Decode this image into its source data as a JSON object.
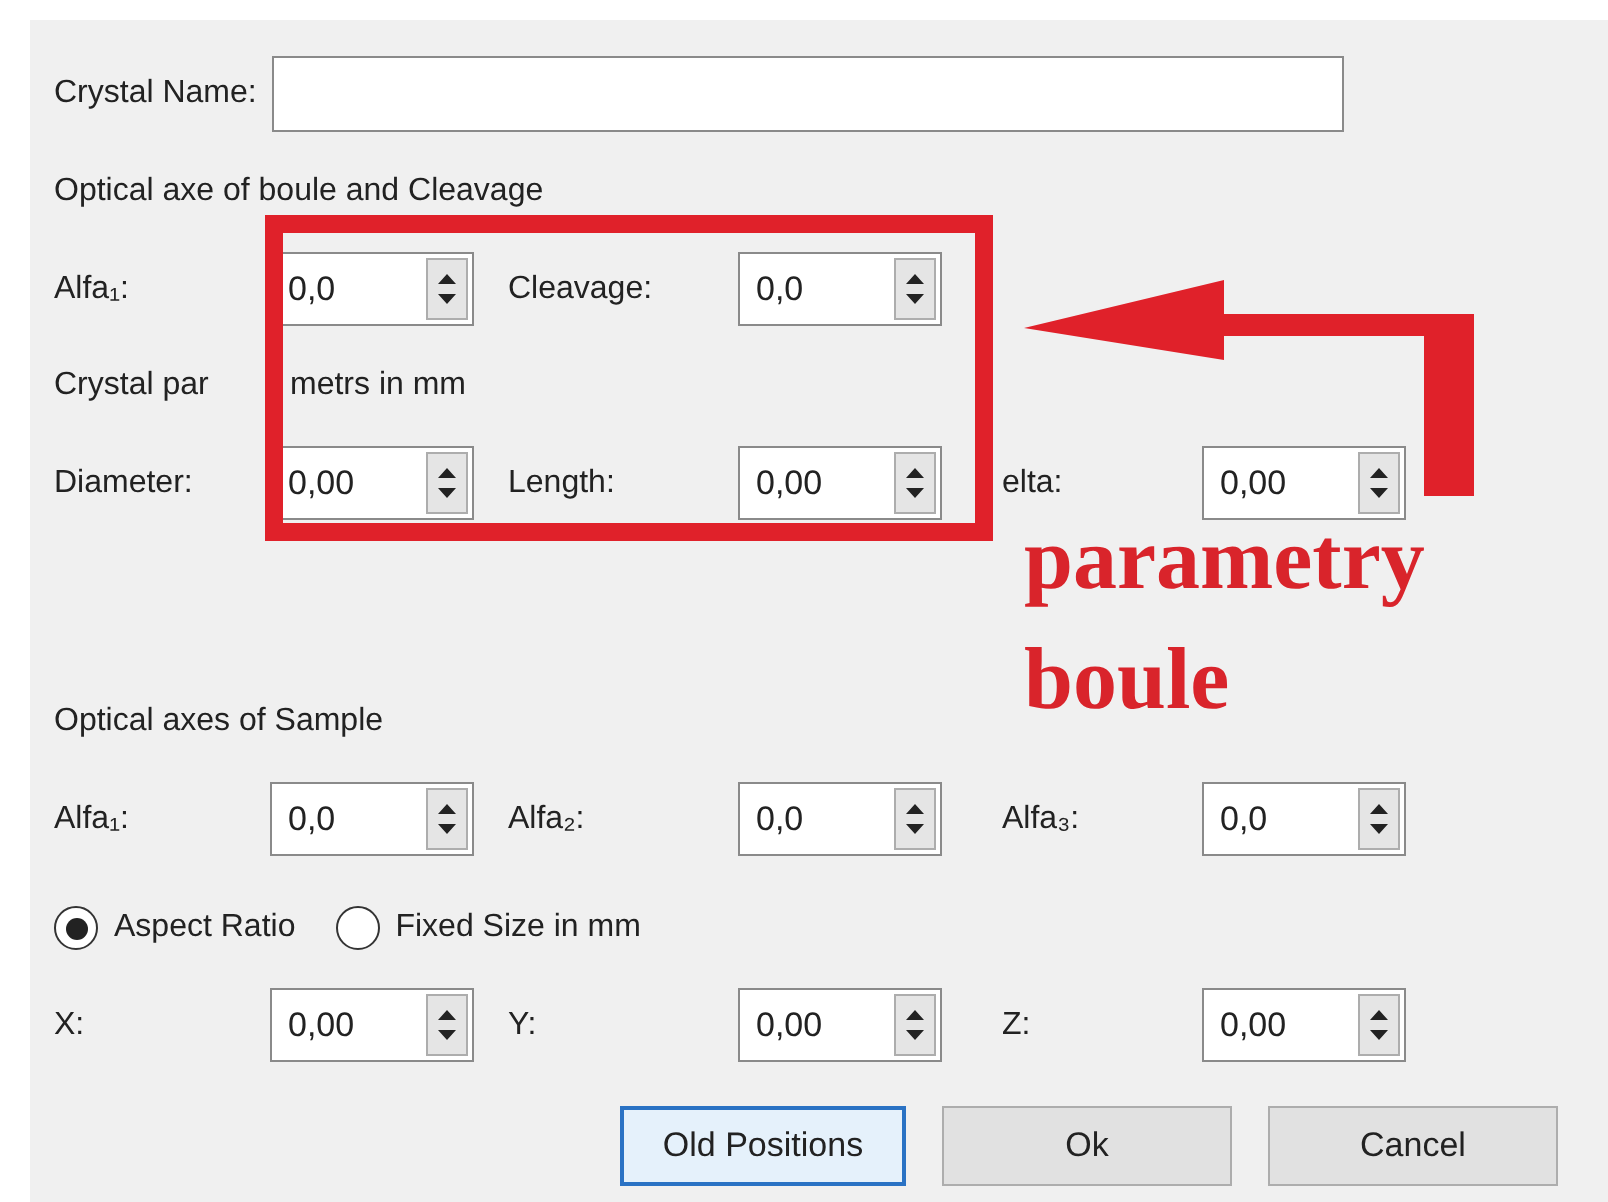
{
  "rows": [
    {
      "kind": "field",
      "label": "Crystal Name:"
    },
    {
      "kind": "heading",
      "text": "Optical axe of boule and Cleavage"
    },
    {
      "kind": "spins",
      "items": [
        {
          "label": "Alfa₁:",
          "value": "0,0"
        },
        {
          "label": "Cleavage:",
          "value": "0,0"
        }
      ]
    },
    {
      "kind": "heading",
      "parts": [
        "Crystal par",
        "metrs in mm"
      ]
    },
    {
      "kind": "spins",
      "items": [
        {
          "label": "Diameter:",
          "value": "0,00"
        },
        {
          "label": "Length:",
          "value": "0,00"
        },
        {
          "label": "elta:",
          "value": "0,00"
        }
      ]
    },
    {
      "kind": "heading",
      "text": "Optical axes of Sample"
    },
    {
      "kind": "spins",
      "items": [
        {
          "label": "Alfa₁:",
          "value": "0,0"
        },
        {
          "label": "Alfa₂:",
          "value": "0,0"
        },
        {
          "label": "Alfa₃:",
          "value": "0,0"
        }
      ]
    },
    {
      "kind": "radios",
      "items": [
        {
          "label": "Aspect Ratio",
          "selected": true
        },
        {
          "label": "Fixed Size in mm",
          "selected": false
        }
      ]
    },
    {
      "kind": "spins",
      "items": [
        {
          "label": "X:",
          "value": "0,00"
        },
        {
          "label": "Y:",
          "value": "0,00"
        },
        {
          "label": "Z:",
          "value": "0,00"
        }
      ]
    },
    {
      "kind": "buttons",
      "items": [
        {
          "label": "Old Positions",
          "focused": true
        },
        {
          "label": "Ok",
          "focused": false
        },
        {
          "label": "Cancel",
          "focused": false
        }
      ]
    }
  ],
  "annotation": {
    "lines": [
      "parametry",
      "boule"
    ]
  }
}
